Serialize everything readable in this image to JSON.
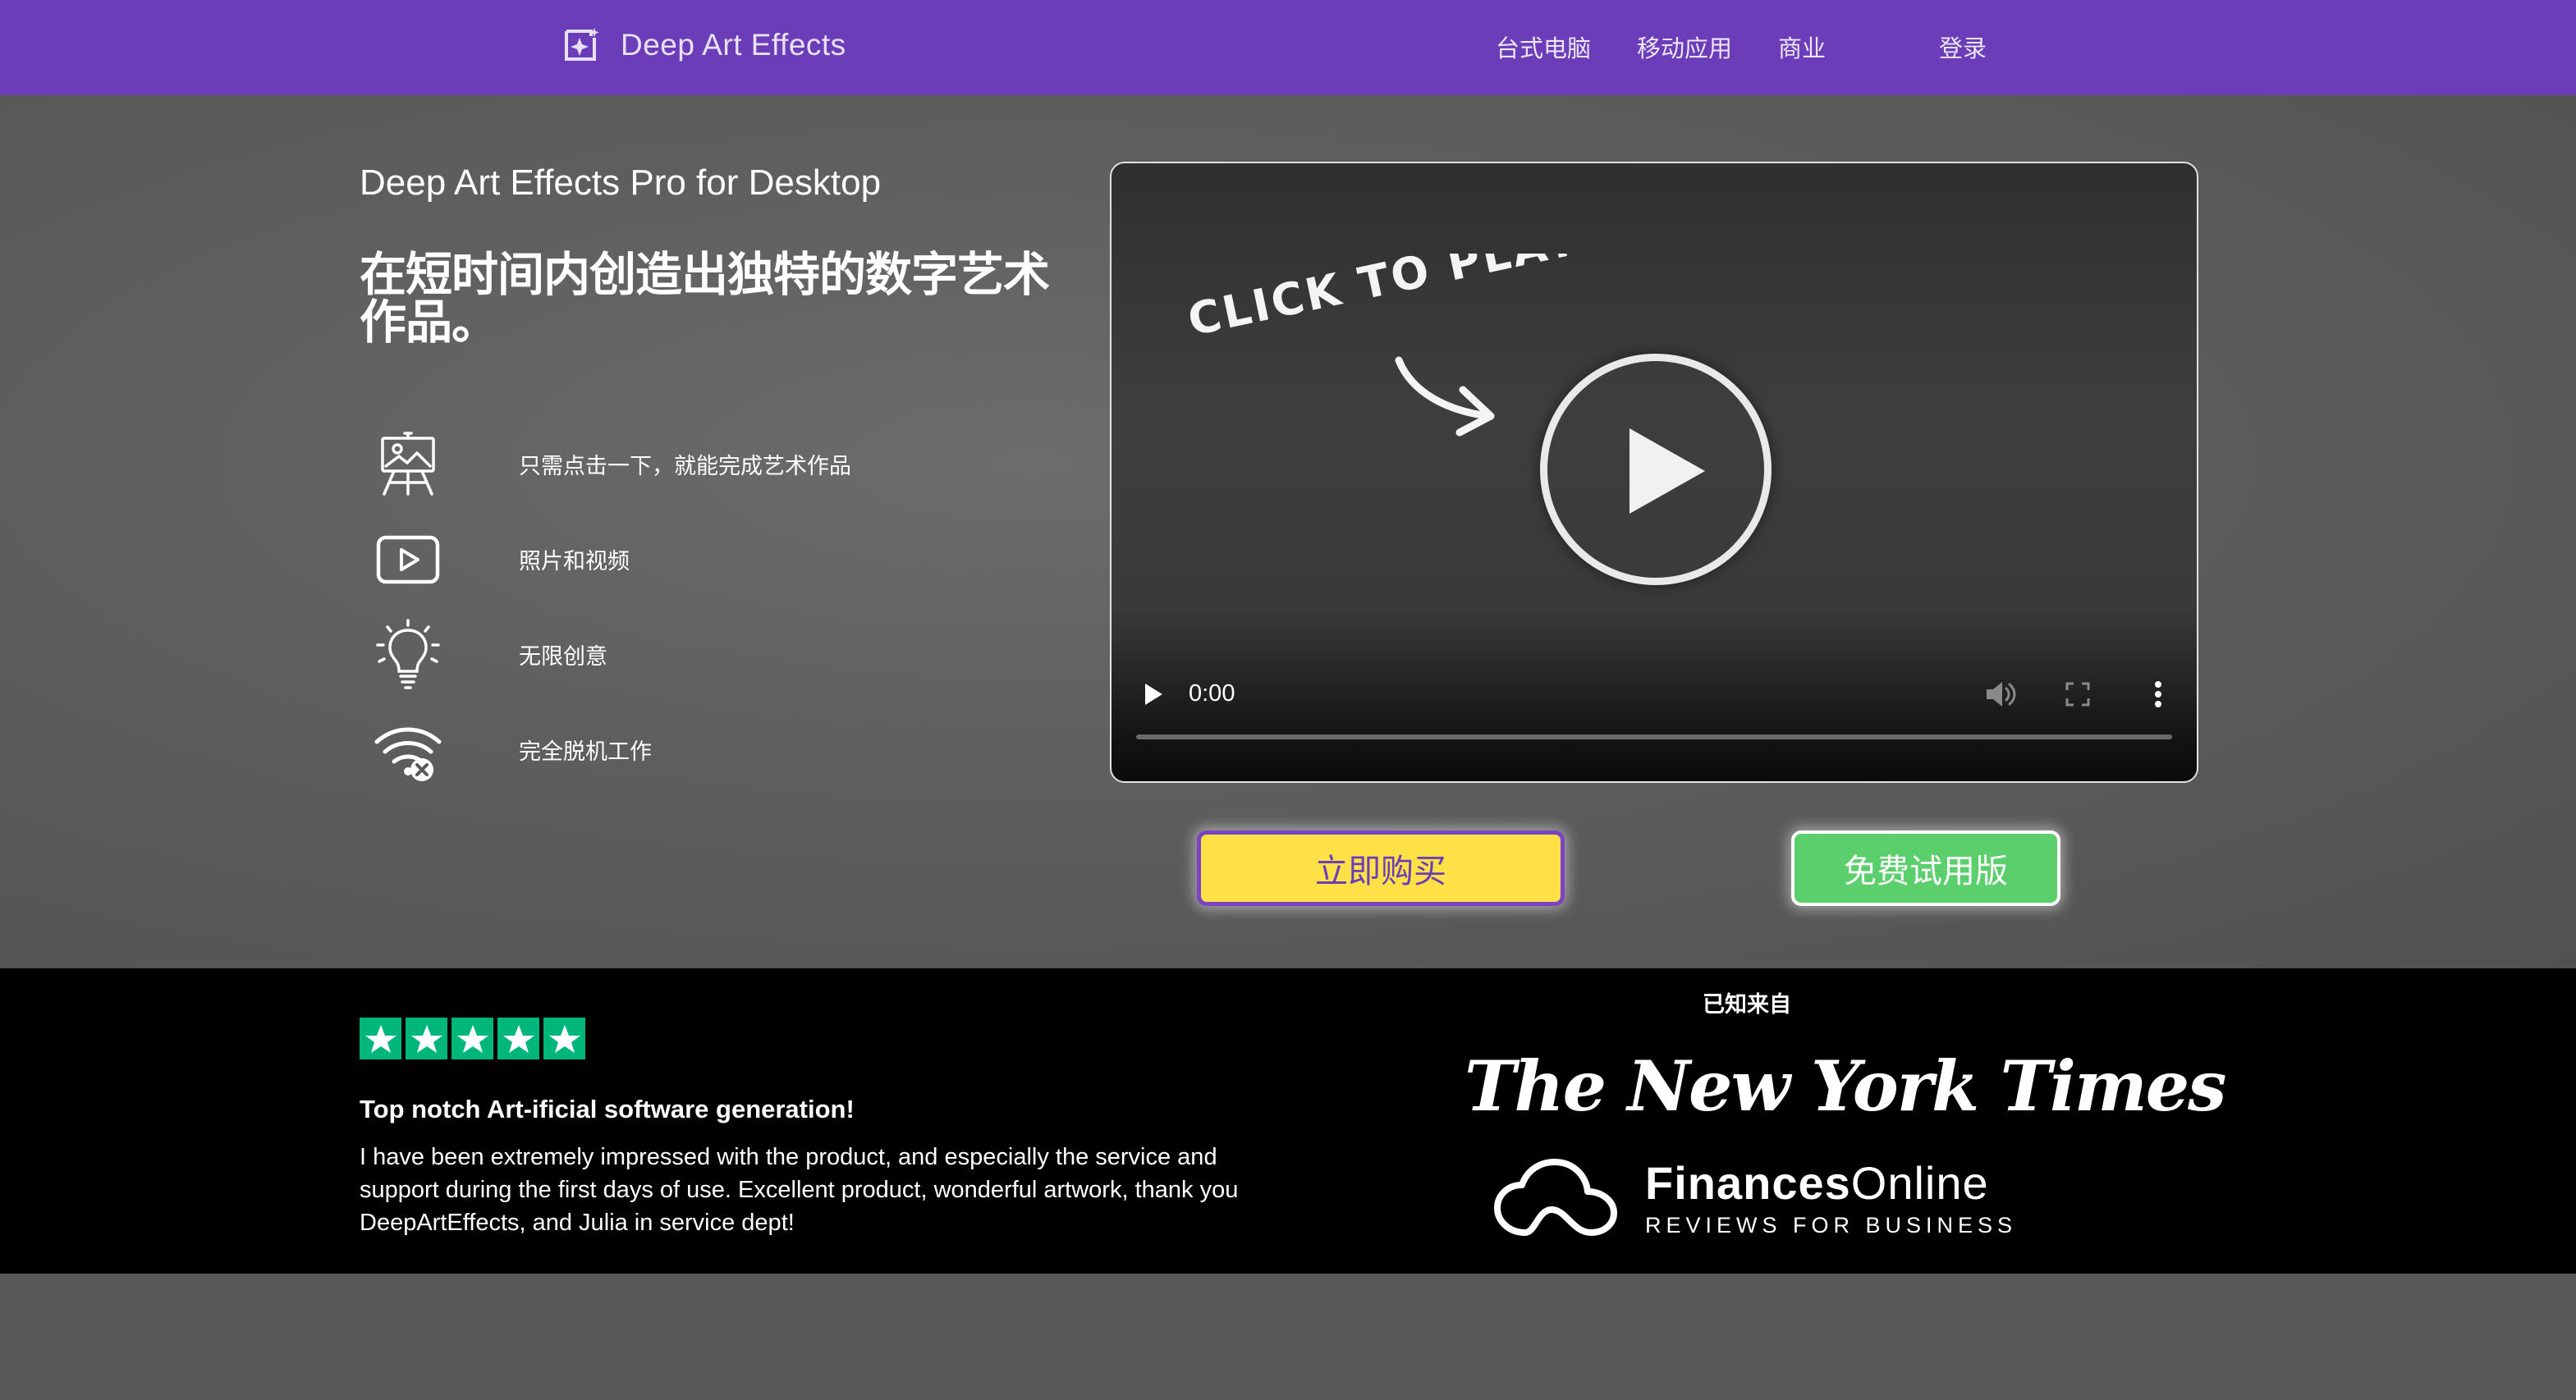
{
  "nav": {
    "brand": "Deep Art Effects",
    "links": [
      "台式电脑",
      "移动应用",
      "商业",
      "登录"
    ]
  },
  "hero": {
    "subtitle": "Deep Art Effects Pro for Desktop",
    "title": "在短时间内创造出独特的数字艺术作品。",
    "features": [
      {
        "icon": "easel-icon",
        "label": "只需点击一下，就能完成艺术作品"
      },
      {
        "icon": "play-video-icon",
        "label": "照片和视频"
      },
      {
        "icon": "lightbulb-icon",
        "label": "无限创意"
      },
      {
        "icon": "wifi-off-icon",
        "label": "完全脱机工作"
      }
    ]
  },
  "video": {
    "overlay_text": "CLICK TO PLAY!",
    "time": "0:00"
  },
  "cta": {
    "buy_label": "立即购买",
    "trial_label": "免费试用版"
  },
  "review": {
    "rating_stars": 5,
    "title": "Top notch Art-ificial software generation!",
    "body": "I have been extremely impressed with the product, and especially the service and support during the first days of use. Excellent product, wonderful artwork, thank you DeepArtEffects, and Julia in service dept!"
  },
  "press": {
    "heading": "已知来自",
    "nyt": "The New York Times",
    "fo_name_bold": "Finances",
    "fo_name_rest": "Online",
    "fo_tagline": "REVIEWS FOR BUSINESS"
  },
  "colors": {
    "nav_bg": "#6b3db8",
    "buy_bg": "#fde147",
    "trial_bg": "#5bcf6c",
    "trustpilot_green": "#00b67a"
  }
}
